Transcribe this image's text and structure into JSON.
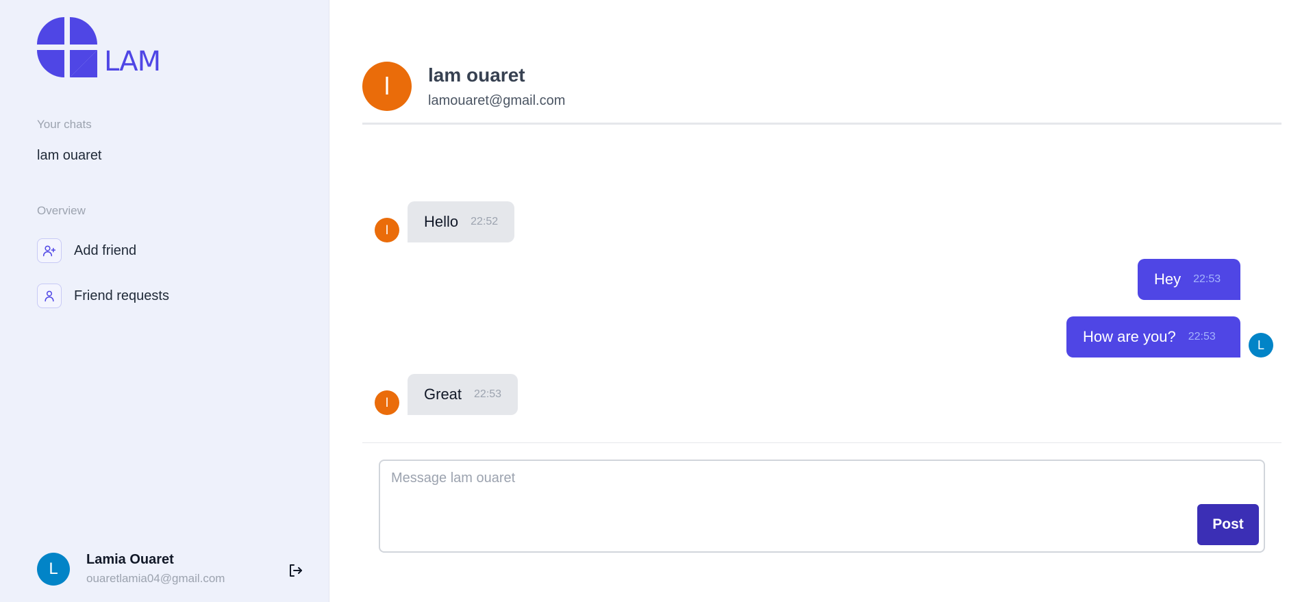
{
  "brand": {
    "logo_text": "LAM",
    "color": "#4f46e5"
  },
  "sidebar": {
    "chats_label": "Your chats",
    "chats": [
      {
        "name": "lam ouaret"
      }
    ],
    "overview_label": "Overview",
    "nav": [
      {
        "label": "Add friend",
        "icon": "user-plus-icon"
      },
      {
        "label": "Friend requests",
        "icon": "user-icon"
      }
    ],
    "profile": {
      "initial": "L",
      "name": "Lamia Ouaret",
      "email": "ouaretlamia04@gmail.com",
      "logout_icon": "logout-icon"
    }
  },
  "chat": {
    "partner": {
      "initial": "l",
      "name": "lam ouaret",
      "email": "lamouaret@gmail.com"
    },
    "messages": [
      {
        "from": "partner",
        "avatar": "l",
        "text": "Hello",
        "time": "22:52"
      },
      {
        "from": "me",
        "text": "Hey",
        "time": "22:53"
      },
      {
        "from": "me",
        "avatar": "L",
        "text": "How are you?",
        "time": "22:53"
      },
      {
        "from": "partner",
        "avatar": "l",
        "text": "Great",
        "time": "22:53"
      }
    ],
    "composer": {
      "placeholder": "Message lam ouaret",
      "value": "",
      "post_label": "Post"
    }
  },
  "colors": {
    "sidebar_bg": "#eef1fb",
    "partner_avatar": "#ea6c0a",
    "my_avatar": "#0284c7",
    "outgoing_bubble": "#4f46e5",
    "incoming_bubble": "#e5e7eb",
    "post_button": "#3b2fb5"
  }
}
